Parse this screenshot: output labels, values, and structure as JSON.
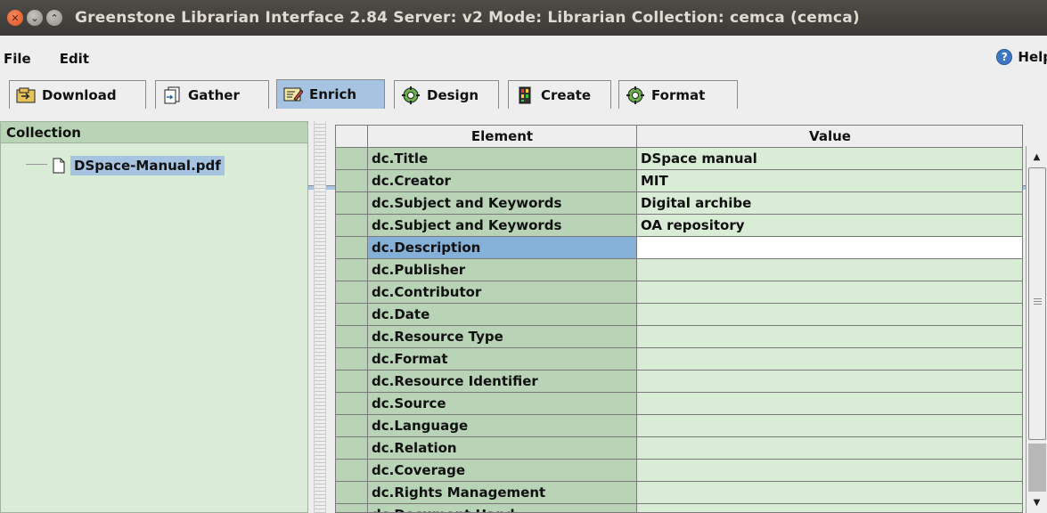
{
  "window": {
    "title": "Greenstone Librarian Interface 2.84  Server: v2  Mode: Librarian  Collection: cemca (cemca)"
  },
  "menu": {
    "items": [
      "File",
      "Edit"
    ],
    "help_label": "Help"
  },
  "tabs": [
    {
      "label": "Download",
      "icon": "download-icon"
    },
    {
      "label": "Gather",
      "icon": "gather-icon"
    },
    {
      "label": "Enrich",
      "icon": "enrich-icon",
      "active": true
    },
    {
      "label": "Design",
      "icon": "gear-icon"
    },
    {
      "label": "Create",
      "icon": "create-icon"
    },
    {
      "label": "Format",
      "icon": "gear-icon"
    }
  ],
  "collection": {
    "header": "Collection",
    "file": "DSpace-Manual.pdf"
  },
  "metadata_table": {
    "columns": [
      "Element",
      "Value"
    ],
    "rows": [
      {
        "element": "dc.Title",
        "value": "DSpace manual"
      },
      {
        "element": "dc.Creator",
        "value": "MIT"
      },
      {
        "element": "dc.Subject and Keywords",
        "value": "Digital archibe"
      },
      {
        "element": "dc.Subject and Keywords",
        "value": "OA repository"
      },
      {
        "element": "dc.Description",
        "value": "",
        "selected": true
      },
      {
        "element": "dc.Publisher",
        "value": ""
      },
      {
        "element": "dc.Contributor",
        "value": ""
      },
      {
        "element": "dc.Date",
        "value": ""
      },
      {
        "element": "dc.Resource Type",
        "value": ""
      },
      {
        "element": "dc.Format",
        "value": ""
      },
      {
        "element": "dc.Resource Identifier",
        "value": ""
      },
      {
        "element": "dc.Source",
        "value": ""
      },
      {
        "element": "dc.Language",
        "value": ""
      },
      {
        "element": "dc.Relation",
        "value": ""
      },
      {
        "element": "dc.Coverage",
        "value": ""
      },
      {
        "element": "dc.Rights Management",
        "value": ""
      },
      {
        "element": "dc.Document Hand",
        "value": ""
      }
    ]
  },
  "colors": {
    "accent_blue": "#a6c3e1",
    "panel_green": "#d8ecd6",
    "header_green": "#b8d3b6",
    "selected_blue": "#85b0d8",
    "titlebar": "#3c3b37"
  }
}
